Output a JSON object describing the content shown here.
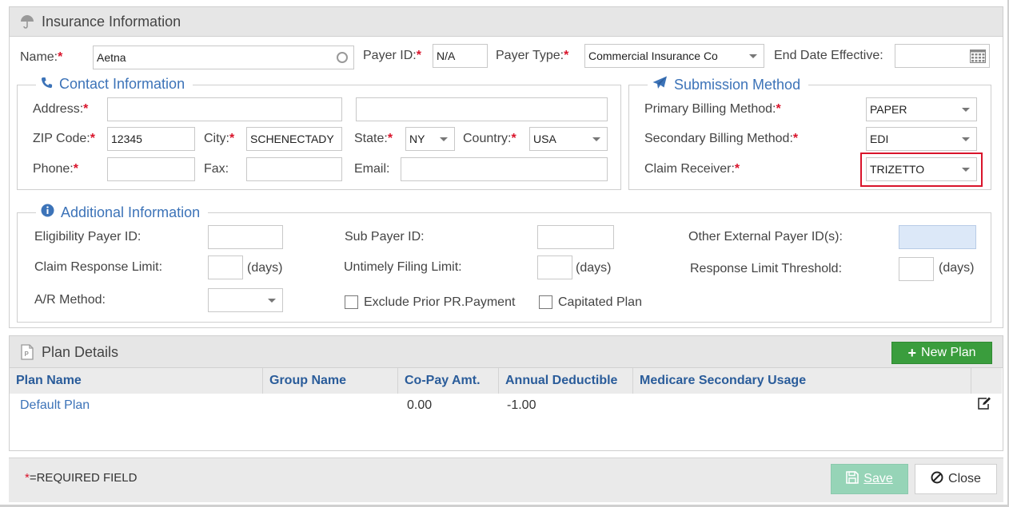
{
  "insurance": {
    "title": "Insurance Information",
    "name_label": "Name:",
    "name_value": "Aetna",
    "payer_id_label": "Payer ID:",
    "payer_id_value": "N/A",
    "payer_type_label": "Payer Type:",
    "payer_type_value": "Commercial Insurance Co",
    "end_date_label": "End Date Effective:",
    "end_date_value": ""
  },
  "contact": {
    "legend": "Contact Information",
    "address_label": "Address:",
    "address1_value": "",
    "address2_value": "",
    "zip_label": "ZIP Code:",
    "zip_value": "12345",
    "city_label": "City:",
    "city_value": "SCHENECTADY",
    "state_label": "State:",
    "state_value": "NY",
    "country_label": "Country:",
    "country_value": "USA",
    "phone_label": "Phone:",
    "phone_value": "",
    "fax_label": "Fax:",
    "fax_value": "",
    "email_label": "Email:",
    "email_value": ""
  },
  "submission": {
    "legend": "Submission Method",
    "primary_label": "Primary Billing Method:",
    "primary_value": "PAPER",
    "secondary_label": "Secondary Billing Method:",
    "secondary_value": "EDI",
    "receiver_label": "Claim Receiver:",
    "receiver_value": "TRIZETTO",
    "highlight_color": "#d9142b"
  },
  "additional": {
    "legend": "Additional Information",
    "eligibility_label": "Eligibility Payer ID:",
    "sub_payer_label": "Sub Payer ID:",
    "other_external_label": "Other External Payer ID(s):",
    "claim_response_label": "Claim Response Limit:",
    "untimely_label": "Untimely Filing Limit:",
    "response_threshold_label": "Response Limit Threshold:",
    "days_label": "(days)",
    "ar_method_label": "A/R Method:",
    "exclude_label": "Exclude Prior PR.Payment",
    "capitated_label": "Capitated Plan"
  },
  "plans": {
    "title": "Plan Details",
    "new_plan_label": "New Plan",
    "columns": [
      "Plan Name",
      "Group Name",
      "Co-Pay Amt.",
      "Annual Deductible",
      "Medicare Secondary Usage"
    ],
    "rows": [
      {
        "plan_name": "Default Plan",
        "group_name": "",
        "copay": "0.00",
        "deductible": "-1.00",
        "medicare": ""
      }
    ]
  },
  "footer": {
    "required_star": "*",
    "required_text": "=REQUIRED FIELD",
    "save_label": "Save",
    "close_label": "Close"
  },
  "colors": {
    "accent_blue": "#3c73b8",
    "required_red": "#d9142b",
    "new_plan_green": "#3a9d3d",
    "save_disabled": "#96d4b7"
  }
}
